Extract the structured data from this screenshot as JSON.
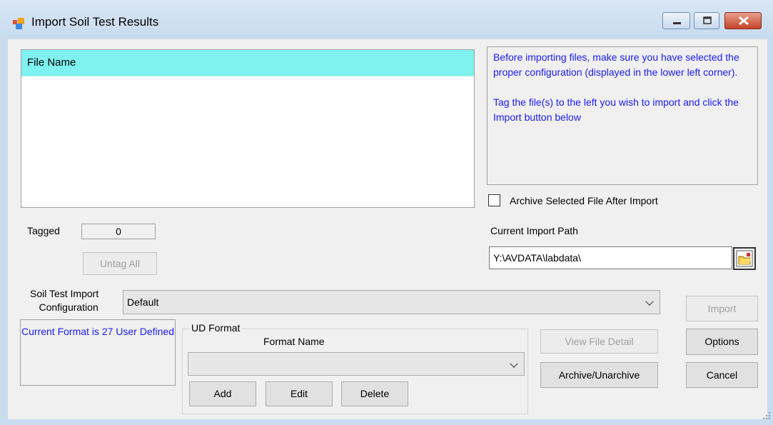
{
  "window": {
    "title": "Import Soil Test Results"
  },
  "file_list": {
    "header": "File Name",
    "rows": []
  },
  "info": {
    "paragraph1": "Before importing files, make sure you have selected the proper configuration (displayed in the lower left corner).",
    "paragraph2": "Tag the file(s) to the left you wish to import and click the Import button below"
  },
  "archive_checkbox": {
    "label": "Archive Selected File After Import",
    "checked": false
  },
  "tagged": {
    "label": "Tagged",
    "value": "0"
  },
  "untag_all_label": "Untag All",
  "import_path": {
    "label": "Current Import Path",
    "value": "Y:\\AVDATA\\labdata\\"
  },
  "config": {
    "label_line1": "Soil Test Import",
    "label_line2": "Configuration",
    "value": "Default"
  },
  "current_format": "Current Format is 27 User Defined",
  "ud_format": {
    "group_label": "UD Format",
    "format_name_label": "Format Name",
    "format_name_value": "",
    "add_label": "Add",
    "edit_label": "Edit",
    "delete_label": "Delete"
  },
  "buttons": {
    "view_file_detail": "View File Detail",
    "archive_unarchive": "Archive/Unarchive",
    "import": "Import",
    "options": "Options",
    "cancel": "Cancel"
  },
  "colors": {
    "list_header_bg": "#7ff1ef",
    "info_text": "#1a1aff",
    "title_bar": "#c9dcf0"
  }
}
